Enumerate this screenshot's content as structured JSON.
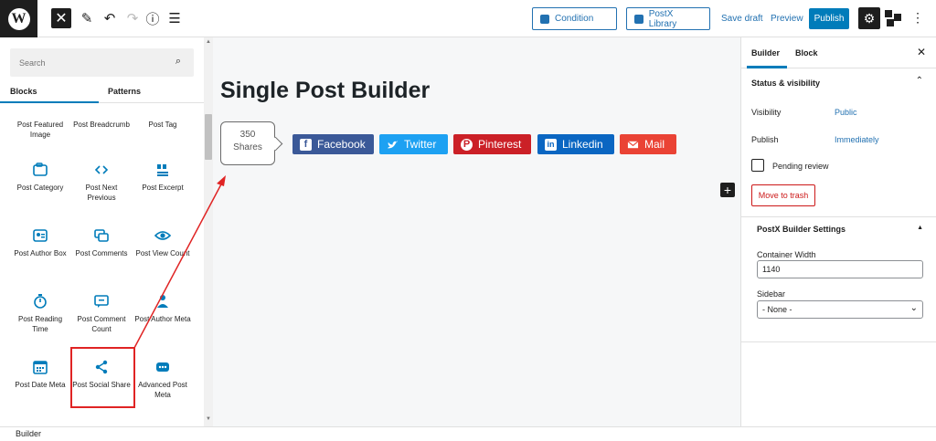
{
  "topbar": {
    "condition_label": "Condition",
    "postx_library_label": "PostX Library",
    "save_draft_label": "Save draft",
    "preview_label": "Preview",
    "publish_label": "Publish"
  },
  "inserter": {
    "search_placeholder": "Search",
    "tabs": [
      "Blocks",
      "Patterns"
    ],
    "blocks": [
      {
        "label": "Post Featured Image",
        "icon": "image-icon"
      },
      {
        "label": "Post Breadcrumb",
        "icon": "breadcrumb-icon"
      },
      {
        "label": "Post Tag",
        "icon": "tag-icon"
      },
      {
        "label": "Post Category",
        "icon": "folder-icon"
      },
      {
        "label": "Post Next Previous",
        "icon": "next-previous-icon"
      },
      {
        "label": "Post Excerpt",
        "icon": "excerpt-icon"
      },
      {
        "label": "Post Author Box",
        "icon": "author-box-icon"
      },
      {
        "label": "Post Comments",
        "icon": "comments-icon"
      },
      {
        "label": "Post View Count",
        "icon": "eye-icon"
      },
      {
        "label": "Post Reading Time",
        "icon": "stopwatch-icon"
      },
      {
        "label": "Post Comment Count",
        "icon": "comment-count-icon"
      },
      {
        "label": "Post Author Meta",
        "icon": "author-meta-icon"
      },
      {
        "label": "Post Date Meta",
        "icon": "calendar-icon"
      },
      {
        "label": "Post Social Share",
        "icon": "share-icon"
      },
      {
        "label": "Advanced Post Meta",
        "icon": "advanced-meta-icon"
      }
    ]
  },
  "canvas": {
    "title": "Single Post Builder",
    "share_count_value": "350",
    "share_count_label": "Shares",
    "share_buttons": [
      {
        "label": "Facebook",
        "color": "#3b5998"
      },
      {
        "label": "Twitter",
        "color": "#1da1f2"
      },
      {
        "label": "Pinterest",
        "color": "#cb2027"
      },
      {
        "label": "Linkedin",
        "color": "#0a66c2"
      },
      {
        "label": "Mail",
        "color": "#ea4335"
      }
    ]
  },
  "sidebar": {
    "tabs": [
      "Builder",
      "Block"
    ],
    "status_visibility_title": "Status & visibility",
    "visibility_label": "Visibility",
    "visibility_value": "Public",
    "publish_label": "Publish",
    "publish_value": "Immediately",
    "pending_review_label": "Pending review",
    "move_to_trash_label": "Move to trash",
    "postx_settings_title": "PostX Builder Settings",
    "container_width_label": "Container Width",
    "container_width_value": "1140",
    "sidebar_label": "Sidebar",
    "sidebar_value": "- None -"
  },
  "footer": {
    "breadcrumb": "Builder"
  },
  "colors": {
    "accent": "#007cba",
    "link": "#2271b1",
    "highlight": "#e02424"
  }
}
